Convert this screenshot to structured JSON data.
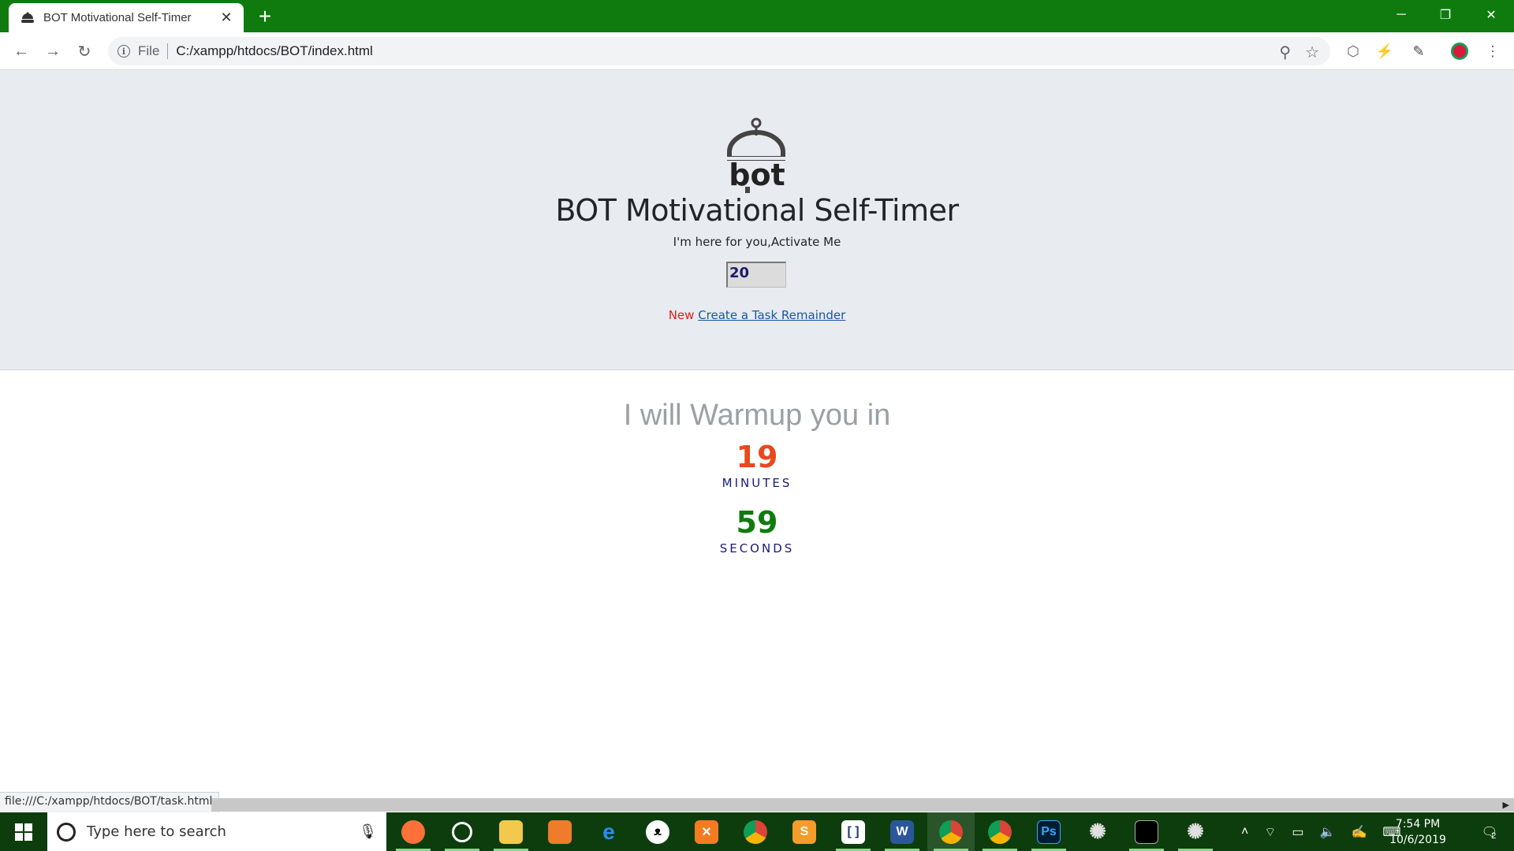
{
  "browser": {
    "tab_title": "BOT Motivational Self-Timer",
    "new_tab_label": "+",
    "address_scheme": "File",
    "address_url": "C:/xampp/htdocs/BOT/index.html",
    "status_url": "file:///C:/xampp/htdocs/BOT/task.html"
  },
  "page": {
    "logo_text": "bot",
    "title": "BOT Motivational Self-Timer",
    "subtitle": "I'm here for you,Activate Me",
    "minutes_input_value": "20",
    "new_badge": "New",
    "task_link": "Create a Task Remainder",
    "warmup_heading": "I will Warmup you in",
    "minutes_value": "19",
    "minutes_label": "MINUTES",
    "seconds_value": "59",
    "seconds_label": "SECONDS",
    "colors": {
      "minutes": "#e8491d",
      "seconds": "#0f7b0f",
      "labels": "#1a1a7a",
      "hero_bg": "#e8ebef",
      "chrome_frame": "#0f7b0f"
    }
  },
  "taskbar": {
    "search_placeholder": "Type here to search",
    "apps": [
      "firefox-icon",
      "obs-icon",
      "file-explorer-icon",
      "app-icon",
      "edge-icon",
      "cat-icon",
      "xampp-icon",
      "chrome-icon",
      "sublime-icon",
      "bracket-icon",
      "word-icon",
      "chrome-icon",
      "chrome-icon",
      "photoshop-icon",
      "spider-icon",
      "terminal-icon",
      "spider-icon"
    ],
    "clock_time": "7:54 PM",
    "clock_date": "10/6/2019",
    "notification_count": "2"
  }
}
